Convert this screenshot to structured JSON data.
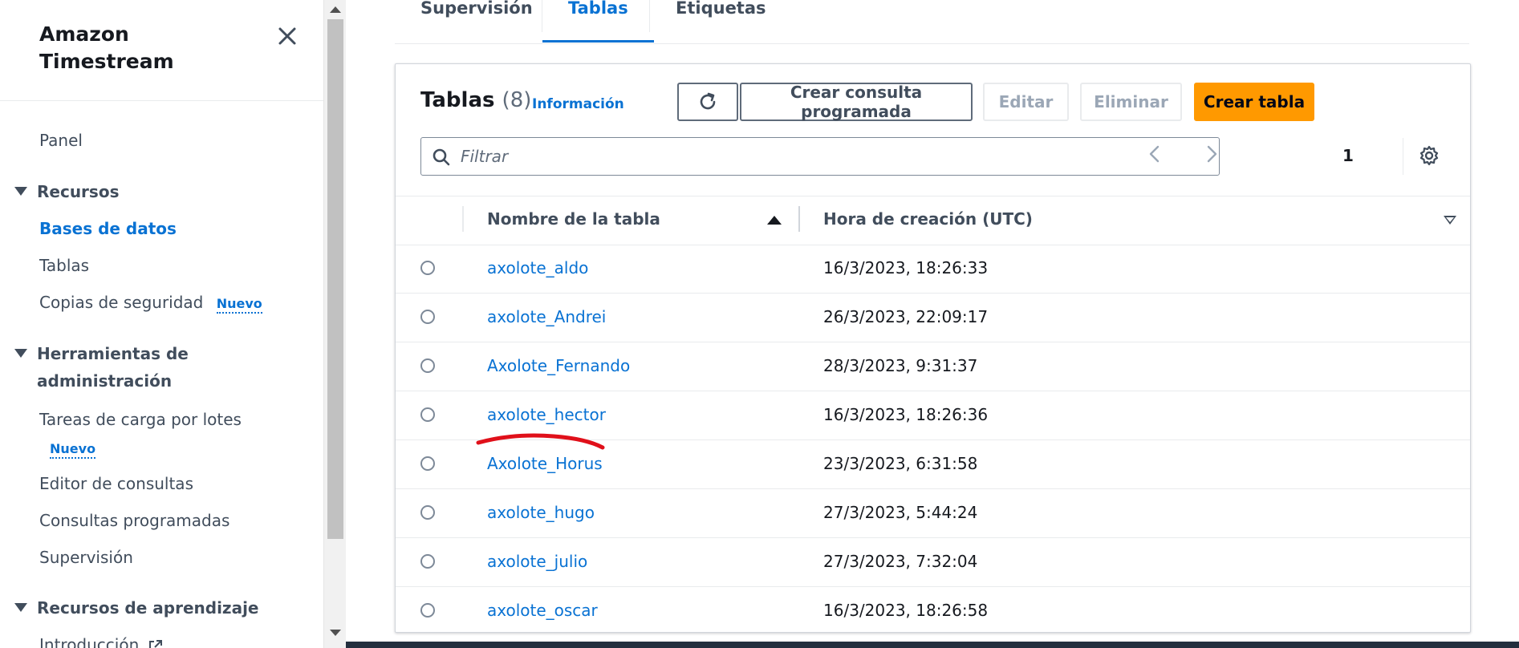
{
  "sidebar": {
    "title_line1": "Amazon",
    "title_line2": "Timestream",
    "panel": "Panel",
    "resources": {
      "heading": "Recursos",
      "databases": "Bases de datos",
      "tables": "Tablas",
      "backups": "Copias de seguridad",
      "backups_badge": "Nuevo"
    },
    "admin": {
      "heading_line1": "Herramientas de",
      "heading_line2": "administración",
      "batch_load": "Tareas de carga por lotes",
      "batch_load_badge": "Nuevo",
      "query_editor": "Editor de consultas",
      "scheduled_queries": "Consultas programadas",
      "monitoring": "Supervisión"
    },
    "learning": {
      "heading": "Recursos de aprendizaje",
      "intro": "Introducción"
    }
  },
  "tabs": [
    {
      "label": "Supervisión",
      "active": false
    },
    {
      "label": "Tablas",
      "active": true
    },
    {
      "label": "Etiquetas",
      "active": false
    }
  ],
  "tables_panel": {
    "title": "Tablas",
    "count": "(8)",
    "info_link": "Información",
    "buttons": {
      "refresh_icon": "refresh-icon",
      "create_scheduled_query": "Crear consulta programada",
      "edit": "Editar",
      "delete": "Eliminar",
      "create_table": "Crear tabla"
    },
    "filter_placeholder": "Filtrar",
    "pagination": {
      "current_page": "1"
    },
    "columns": {
      "name": "Nombre de la tabla",
      "created": "Hora de creación (UTC)"
    },
    "rows": [
      {
        "name": "axolote_aldo",
        "created": "16/3/2023, 18:26:33"
      },
      {
        "name": "axolote_Andrei",
        "created": "26/3/2023, 22:09:17"
      },
      {
        "name": "Axolote_Fernando",
        "created": "28/3/2023, 9:31:37"
      },
      {
        "name": "axolote_hector",
        "created": "16/3/2023, 18:26:36"
      },
      {
        "name": "Axolote_Horus",
        "created": "23/3/2023, 6:31:58"
      },
      {
        "name": "axolote_hugo",
        "created": "27/3/2023, 5:44:24"
      },
      {
        "name": "axolote_julio",
        "created": "27/3/2023, 7:32:04"
      },
      {
        "name": "axolote_oscar",
        "created": "16/3/2023, 18:26:58"
      }
    ]
  },
  "colors": {
    "link": "#0972d3",
    "primary_button": "#ff9900",
    "annotation_underline": "#e0101a"
  }
}
